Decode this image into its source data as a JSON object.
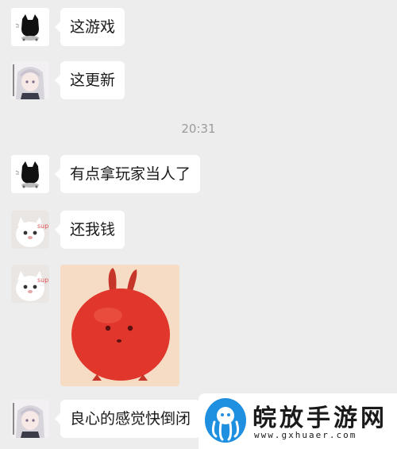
{
  "chat": {
    "messages": [
      {
        "avatar": "black-cat-avatar",
        "text": "这游戏"
      },
      {
        "avatar": "anime-girl-avatar",
        "text": "这更新"
      },
      {
        "avatar": "black-cat-avatar",
        "text": "有点拿玩家当人了"
      },
      {
        "avatar": "cat-sticker-avatar",
        "text": "还我钱"
      },
      {
        "avatar": "cat-sticker-avatar",
        "sticker": "red-bunny-sticker"
      },
      {
        "avatar": "anime-girl-avatar",
        "text": "良心的感觉快倒闭"
      }
    ],
    "timestamp": "20:31",
    "avatar_text_sup": "sup"
  },
  "watermark": {
    "title": "皖放手游网",
    "url": "www.gxhuaer.com",
    "logo": "octopus-logo-icon"
  },
  "colors": {
    "background": "#ededed",
    "bubble": "#ffffff",
    "timestamp": "#9b9b9b",
    "sticker_red": "#e0362b",
    "logo_blue": "#1f8fe0"
  }
}
